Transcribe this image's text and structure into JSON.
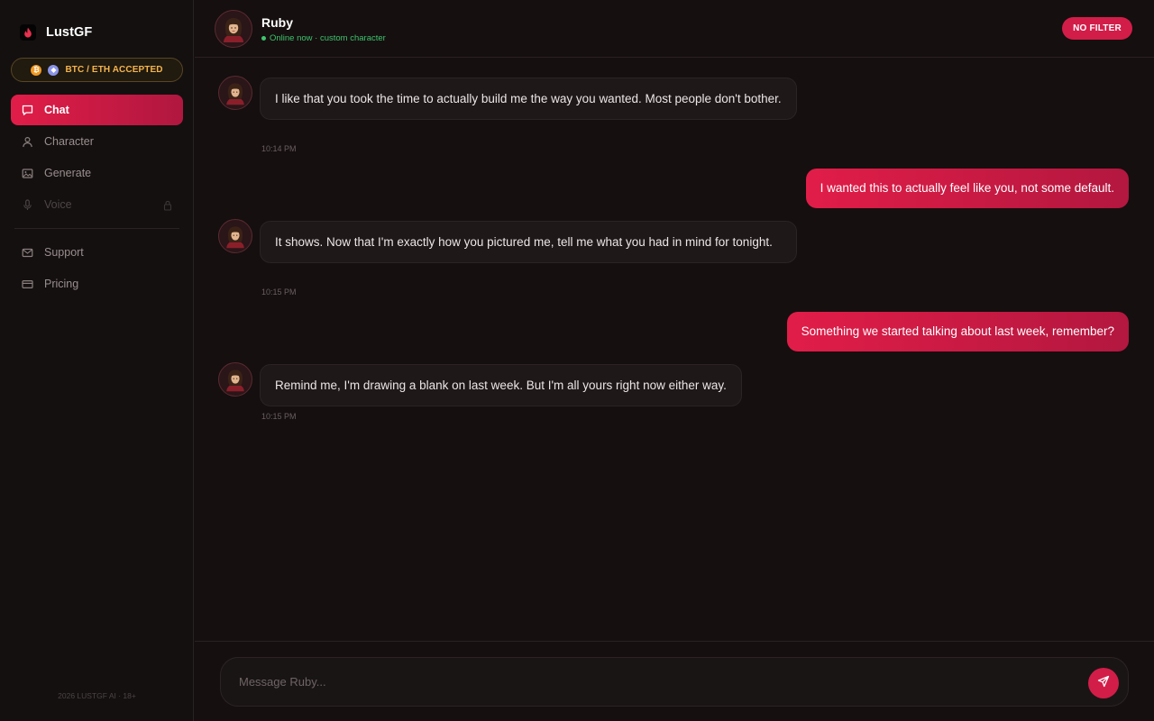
{
  "brand": {
    "name": "LustGF",
    "icon": "flame-icon"
  },
  "crypto_badge": {
    "label": "BTC / ETH ACCEPTED",
    "btc_glyph": "₿",
    "eth_glyph": "◆"
  },
  "nav": {
    "items": [
      {
        "label": "Chat",
        "icon": "chat-icon",
        "active": true
      },
      {
        "label": "Character",
        "icon": "user-icon"
      },
      {
        "label": "Generate",
        "icon": "image-icon"
      },
      {
        "label": "Voice",
        "icon": "microphone-icon",
        "locked": true
      }
    ],
    "secondary": [
      {
        "label": "Support",
        "icon": "mail-icon"
      },
      {
        "label": "Pricing",
        "icon": "credit-card-icon"
      }
    ]
  },
  "footer": {
    "text": "2026 LUSTGF AI · 18+"
  },
  "header": {
    "name": "Ruby",
    "status": "Online now · custom character",
    "badge": "NO FILTER"
  },
  "messages": [
    {
      "from": "character",
      "text": "I like that you took the time to actually build me the way you wanted. Most people don't bother.",
      "time": "10:14 PM"
    },
    {
      "from": "user",
      "text": "I wanted this to actually feel like you, not some default."
    },
    {
      "from": "character",
      "text": "It shows. Now that I'm exactly how you pictured me, tell me what you had in mind for tonight.",
      "time": "10:15 PM"
    },
    {
      "from": "user",
      "text": "Something we started talking about last week, remember?"
    },
    {
      "from": "character",
      "text": "Remind me, I'm drawing a blank on last week. But I'm all yours right now either way.",
      "time": "10:15 PM"
    }
  ],
  "composer": {
    "placeholder": "Message Ruby...",
    "value": ""
  },
  "colors": {
    "accent": "#e11d48",
    "online": "#3ec46d",
    "crypto": "#f5b44c",
    "background": "#150f0f"
  }
}
